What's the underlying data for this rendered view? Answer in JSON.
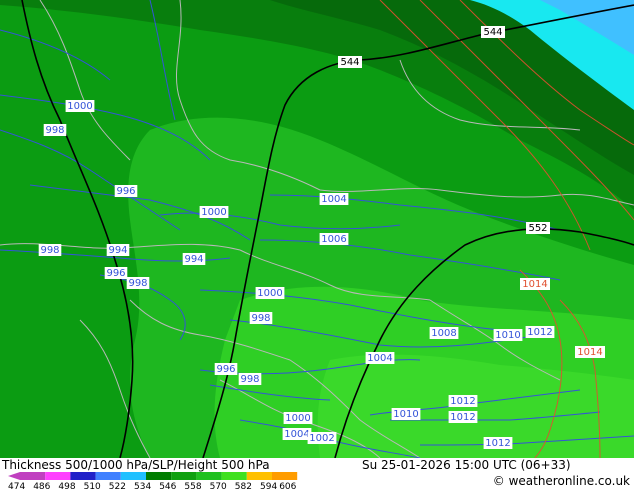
{
  "title": "Thickness 500/1000 hPa/SLP/Height 500 hPa",
  "datetime": "Su 25-01-2026 15:00 UTC (06+33)",
  "credit": "© weatheronline.co.uk",
  "legend": {
    "ticks": [
      "474",
      "486",
      "498",
      "510",
      "522",
      "534",
      "546",
      "558",
      "570",
      "582",
      "594",
      "606"
    ],
    "colors": [
      "#c040c0",
      "#ff40ff",
      "#2020c8",
      "#4080ff",
      "#20c0ff",
      "#007c00",
      "#10a010",
      "#20c020",
      "#40e020",
      "#ffc000",
      "#ff9c00"
    ]
  },
  "colors": {
    "thickness_546": "#0b9c12",
    "thickness_540": "#087e0d",
    "thickness_534": "#066a0b",
    "thickness_552": "#1eb720",
    "thickness_558": "#2fcf25",
    "thickness_cyan": "#18e8f0",
    "thickness_blue": "#40c0ff",
    "isobar": "#3454d8",
    "height_contour": "#000000",
    "warm_isoline": "#e05030",
    "border": "#b8b8b8"
  },
  "height_labels": [
    {
      "text": "544"
    },
    {
      "text": "544"
    },
    {
      "text": "552"
    }
  ],
  "isobar_labels": [
    {
      "text": "1000"
    },
    {
      "text": "998"
    },
    {
      "text": "996"
    },
    {
      "text": "1000"
    },
    {
      "text": "1004"
    },
    {
      "text": "998"
    },
    {
      "text": "994"
    },
    {
      "text": "994"
    },
    {
      "text": "996"
    },
    {
      "text": "998"
    },
    {
      "text": "1006"
    },
    {
      "text": "1000"
    },
    {
      "text": "998"
    },
    {
      "text": "1008"
    },
    {
      "text": "1010"
    },
    {
      "text": "1012"
    },
    {
      "text": "1004"
    },
    {
      "text": "996"
    },
    {
      "text": "998"
    },
    {
      "text": "1010"
    },
    {
      "text": "1012"
    },
    {
      "text": "1012"
    },
    {
      "text": "1000"
    },
    {
      "text": "1004"
    },
    {
      "text": "1002"
    },
    {
      "text": "1012"
    }
  ],
  "warm_labels": [
    {
      "text": "1014"
    },
    {
      "text": "1014"
    }
  ]
}
